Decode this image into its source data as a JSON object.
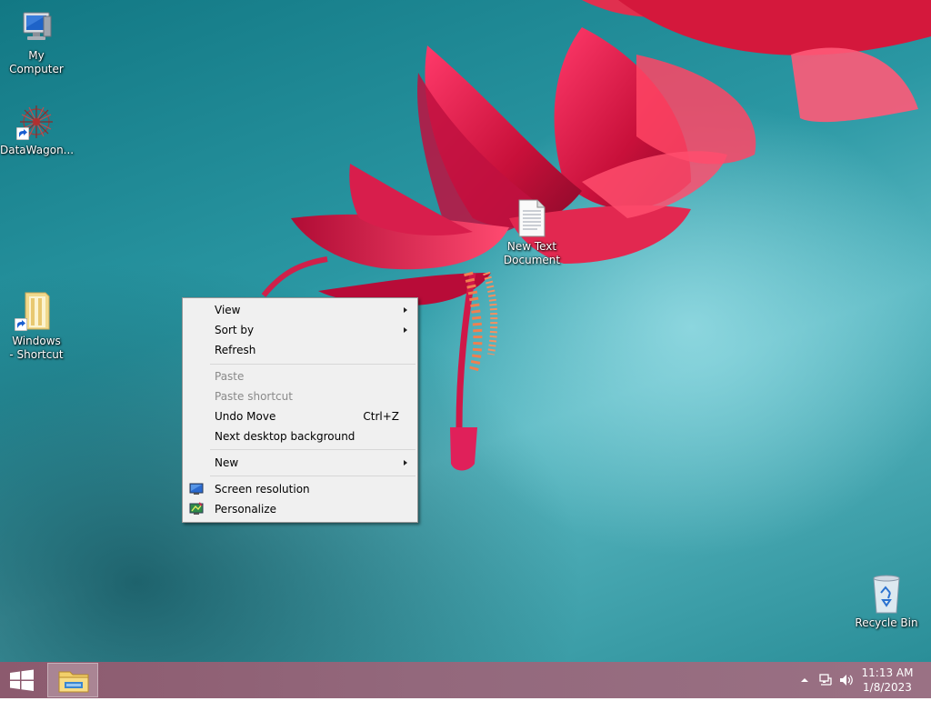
{
  "desktop": {
    "icons": [
      {
        "label": "My Computer",
        "icon": "computer-icon"
      },
      {
        "label": "DataWagon...",
        "icon": "datawagon-icon"
      },
      {
        "label": "Windows - Shortcut",
        "icon": "folder-shortcut-icon"
      },
      {
        "label": "New Text Document",
        "icon": "text-document-icon"
      },
      {
        "label": "Recycle Bin",
        "icon": "recycle-bin-icon"
      }
    ]
  },
  "context_menu": {
    "view": "View",
    "sort_by": "Sort by",
    "refresh": "Refresh",
    "paste": "Paste",
    "paste_shortcut": "Paste shortcut",
    "undo_move": "Undo Move",
    "undo_move_shortcut": "Ctrl+Z",
    "next_background": "Next desktop background",
    "new": "New",
    "screen_resolution": "Screen resolution",
    "personalize": "Personalize"
  },
  "taskbar": {
    "clock_time": "11:13 AM",
    "clock_date": "1/8/2023"
  },
  "colors": {
    "taskbar": "#93687c",
    "desktop_teal": "#2a97a3",
    "flower_red": "#d8204a"
  }
}
